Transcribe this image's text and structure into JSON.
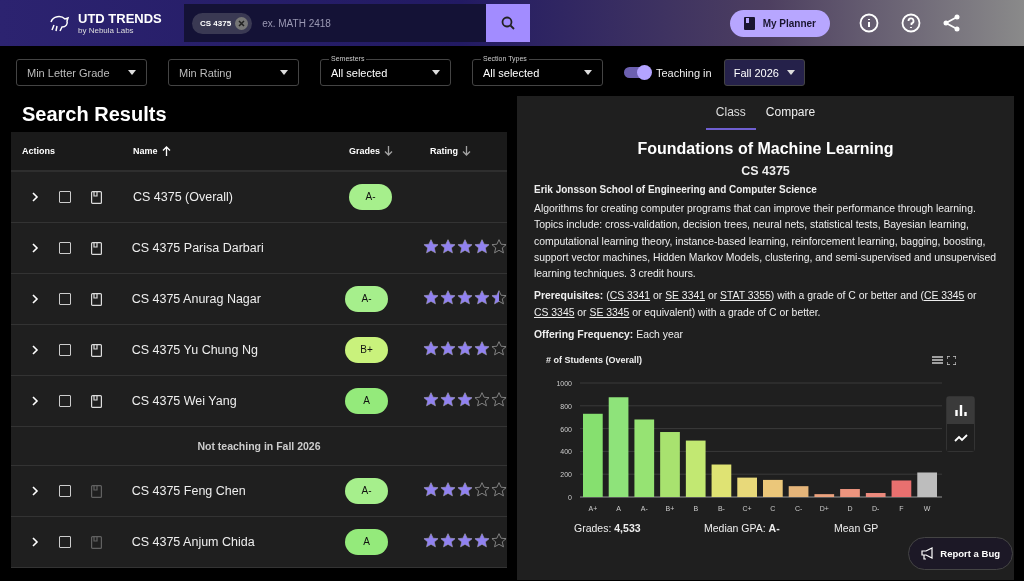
{
  "header": {
    "logo_title": "UTD TRENDS",
    "logo_subtitle": "by Nebula Labs",
    "search": {
      "chips": [
        "CS 4375"
      ],
      "placeholder": "ex. MATH 2418"
    },
    "planner_button": "My Planner"
  },
  "filters": [
    {
      "value": "Min Letter Grade"
    },
    {
      "value": "Min Rating"
    },
    {
      "label": "Semesters",
      "value": "All selected"
    },
    {
      "label": "Section Types",
      "value": "All selected"
    }
  ],
  "teaching": {
    "on": true,
    "label": "Teaching in",
    "semester": "Fall 2026"
  },
  "results": {
    "title": "Search Results",
    "columns": [
      {
        "label": "Actions",
        "sortable": false
      },
      {
        "label": "Name",
        "sortable": true,
        "sort_active": true
      },
      {
        "label": "Grades",
        "sortable": true,
        "sort_active": false
      },
      {
        "label": "Rating",
        "sortable": true,
        "sort_active": false
      }
    ],
    "rows": [
      {
        "kind": "course",
        "name": "CS 4375 (Overall)",
        "checked": false,
        "grade": "A-",
        "color": "#a6ef8c",
        "planner_disabled": false
      },
      {
        "kind": "course",
        "name": "CS 4375 Parisa Darbari",
        "checked": false,
        "stars": 4,
        "planner_disabled": false
      },
      {
        "kind": "course",
        "name": "CS 4375 Anurag Nagar",
        "checked": false,
        "grade": "A-",
        "color": "#a6ef8c",
        "stars": 4.5,
        "planner_disabled": false
      },
      {
        "kind": "course",
        "name": "CS 4375 Yu Chung Ng",
        "checked": false,
        "grade": "B+",
        "color": "#c9f27c",
        "stars": 4,
        "planner_disabled": false
      },
      {
        "kind": "course",
        "name": "CS 4375 Wei Yang",
        "checked": false,
        "grade": "A",
        "color": "#94ea7b",
        "stars": 3,
        "planner_disabled": false
      },
      {
        "kind": "divider",
        "name": "Not teaching in Fall 2026"
      },
      {
        "kind": "course",
        "name": "CS 4375 Feng Chen",
        "checked": false,
        "grade": "A-",
        "color": "#a6ef8c",
        "stars": 3,
        "planner_disabled": true
      },
      {
        "kind": "course",
        "name": "CS 4375 Anjum Chida",
        "checked": false,
        "grade": "A",
        "color": "#94ea7b",
        "stars": 4,
        "planner_disabled": true
      }
    ]
  },
  "detail": {
    "tabs": [
      {
        "label": "Class",
        "selected": true
      },
      {
        "label": "Compare",
        "selected": false
      }
    ],
    "title": "Foundations of Machine Learning",
    "code": "CS 4375",
    "school": "Erik Jonsson School of Engineering and Computer Science",
    "description": "Algorithms for creating computer programs that can improve their performance through learning. Topics include: cross-validation, decision trees, neural nets, statistical tests, Bayesian learning, computational learning theory, instance-based learning, reinforcement learning, bagging, boosting, support vector machines, Hidden Markov Models, clustering, and semi-supervised and unsupervised learning techniques. 3 credit hours.",
    "prerequisites_label": "Prerequisites:",
    "prerequisites": [
      {
        "text": "(",
        "link": false
      },
      {
        "text": "CS 3341",
        "link": true
      },
      {
        "text": " or ",
        "link": false
      },
      {
        "text": "SE 3341",
        "link": true
      },
      {
        "text": " or ",
        "link": false
      },
      {
        "text": "STAT 3355",
        "link": true
      },
      {
        "text": ") with a grade of C or better and (",
        "link": false
      },
      {
        "text": "CE 3345",
        "link": true
      },
      {
        "text": " or ",
        "link": false
      },
      {
        "text": "CS 3345",
        "link": true
      },
      {
        "text": " or ",
        "link": false
      },
      {
        "text": "SE 3345",
        "link": true
      },
      {
        "text": " or equivalent) with a grade of C or better.",
        "link": false
      }
    ],
    "frequency_label": "Offering Frequency:",
    "frequency": "Each year",
    "chart_views": [
      {
        "kind": "bar",
        "selected": true
      },
      {
        "kind": "line",
        "selected": false
      }
    ],
    "chart_data": {
      "type": "bar",
      "title": "# of Students (Overall)",
      "categories": [
        "A+",
        "A",
        "A-",
        "B+",
        "B",
        "B-",
        "C+",
        "C",
        "C-",
        "D+",
        "D",
        "D-",
        "F",
        "W"
      ],
      "grid": true,
      "series": [
        {
          "values": [
            730,
            875,
            680,
            570,
            495,
            285,
            170,
            150,
            95,
            25,
            70,
            35,
            145,
            215
          ]
        }
      ],
      "ylim": [
        0,
        1000
      ],
      "yticks": [
        0,
        200,
        400,
        600,
        800,
        1000
      ]
    },
    "stats": [
      {
        "label": "Grades:",
        "value": "4,533"
      },
      {
        "label": "Median GPA:",
        "value": "A-"
      },
      {
        "label": "Mean GP"
      }
    ]
  },
  "report_button": "Report a Bug"
}
